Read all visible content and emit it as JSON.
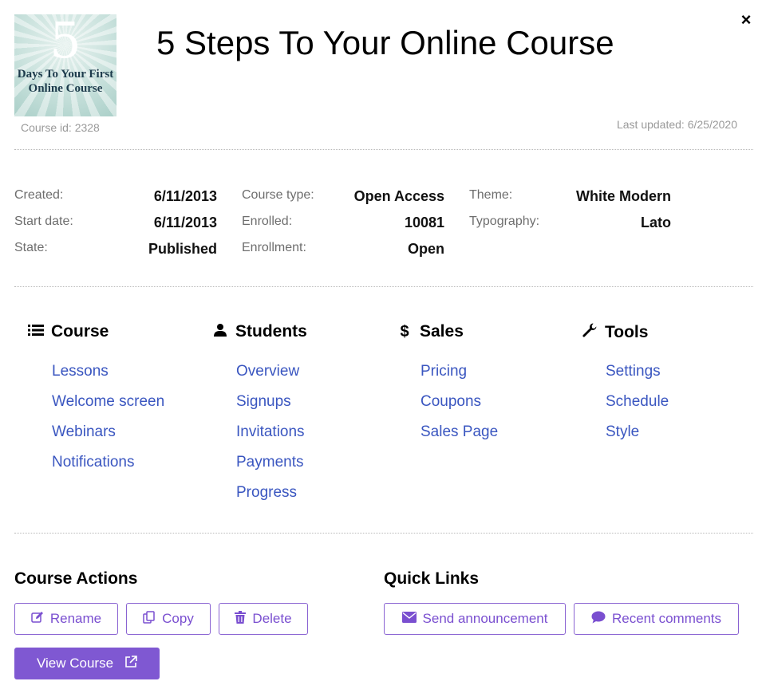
{
  "header": {
    "close_icon": "×",
    "thumbnail": {
      "number": "5",
      "caption": "Days To Your First Online Course"
    },
    "course_id": "Course id: 2328",
    "title": "5 Steps To Your Online Course",
    "last_updated": "Last updated: 6/25/2020"
  },
  "info": {
    "created_label": "Created:",
    "created_value": "6/11/2013",
    "start_label": "Start date:",
    "start_value": "6/11/2013",
    "state_label": "State:",
    "state_value": "Published",
    "type_label": "Course type:",
    "type_value": "Open Access",
    "enrolled_label": "Enrolled:",
    "enrolled_value": "10081",
    "enrollment_label": "Enrollment:",
    "enrollment_value": "Open",
    "theme_label": "Theme:",
    "theme_value": "White Modern",
    "typography_label": "Typography:",
    "typography_value": "Lato"
  },
  "sections": {
    "course": {
      "title": "Course",
      "icon": "list-icon",
      "links": [
        "Lessons",
        "Welcome screen",
        "Webinars",
        "Notifications"
      ]
    },
    "students": {
      "title": "Students",
      "icon": "user-icon",
      "links": [
        "Overview",
        "Signups",
        "Invitations",
        "Payments",
        "Progress"
      ]
    },
    "sales": {
      "title": "Sales",
      "icon": "dollar-icon",
      "links": [
        "Pricing",
        "Coupons",
        "Sales Page"
      ]
    },
    "tools": {
      "title": "Tools",
      "icon": "wrench-icon",
      "links": [
        "Settings",
        "Schedule",
        "Style"
      ]
    }
  },
  "actions": {
    "title": "Course Actions",
    "rename": "Rename",
    "copy": "Copy",
    "delete": "Delete",
    "view": "View Course"
  },
  "quick_links": {
    "title": "Quick Links",
    "announce": "Send announcement",
    "comments": "Recent comments"
  },
  "colors": {
    "accent": "#7f58d2",
    "link": "#3a56c0"
  }
}
